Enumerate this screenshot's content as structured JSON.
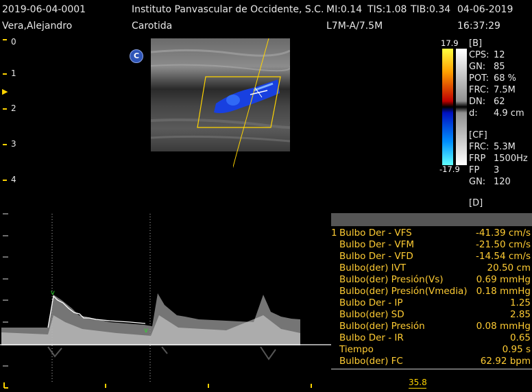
{
  "header": {
    "patient_id": "2019-06-04-0001",
    "institution": "Instituto Panvascular de Occidente, S.C.",
    "mi": "MI:0.14",
    "tis": "TIS:1.08",
    "tib": "TIB:0.34",
    "date": "04-06-2019",
    "patient_name": "Vera,Alejandro",
    "exam": "Carotida",
    "probe": "L7M-A/7.5M",
    "time": "16:37:29"
  },
  "depth_scale": [
    "0",
    "1",
    "2",
    "3",
    "4"
  ],
  "color_scale": {
    "max": "17.9",
    "min": "-17.9"
  },
  "logo_letter": "C",
  "params": {
    "b_title": "[B]",
    "b": [
      {
        "k": "CPS:",
        "v": "12"
      },
      {
        "k": "GN:",
        "v": "85"
      },
      {
        "k": "POT:",
        "v": "68 %"
      },
      {
        "k": "FRC:",
        "v": "7.5M"
      },
      {
        "k": "DN:",
        "v": "62"
      },
      {
        "k": "d:",
        "v": "4.9 cm"
      }
    ],
    "cf_title": "[CF]",
    "cf": [
      {
        "k": "FRC:",
        "v": "5.3M"
      },
      {
        "k": "FRP",
        "v": "1500Hz"
      },
      {
        "k": "FP",
        "v": "3"
      },
      {
        "k": "GN:",
        "v": "120"
      }
    ],
    "d_title": "[D]"
  },
  "measurements": [
    {
      "idx": "1",
      "label": "Bulbo Der - VFS",
      "value": "-41.39 cm/s"
    },
    {
      "idx": "",
      "label": "Bulbo Der - VFM",
      "value": "-21.50 cm/s"
    },
    {
      "idx": "",
      "label": "Bulbo Der - VFD",
      "value": "-14.54 cm/s"
    },
    {
      "idx": "",
      "label": "Bulbo(der) IVT",
      "value": "20.50 cm"
    },
    {
      "idx": "",
      "label": "Bulbo(der) Presión(Vs)",
      "value": "0.69 mmHg"
    },
    {
      "idx": "",
      "label": "Bulbo(der) Presión(Vmedia)",
      "value": "0.18 mmHg"
    },
    {
      "idx": "",
      "label": "Bulbo Der - IP",
      "value": "1.25"
    },
    {
      "idx": "",
      "label": "Bulbo(der) SD",
      "value": "2.85"
    },
    {
      "idx": "",
      "label": "Bulbo(der) Presión",
      "value": "0.08 mmHg"
    },
    {
      "idx": "",
      "label": "Bulbo Der - IR",
      "value": "0.65"
    },
    {
      "idx": "",
      "label": "Tiempo",
      "value": "0.95 s"
    },
    {
      "idx": "",
      "label": "Bulbo(der) FC",
      "value": "62.92 bpm"
    }
  ],
  "sweep_speed": "35.8",
  "colors": {
    "accent": "#ffd400",
    "doppler_blue": "#1a4dff",
    "meas_text": "#ffcc33"
  }
}
